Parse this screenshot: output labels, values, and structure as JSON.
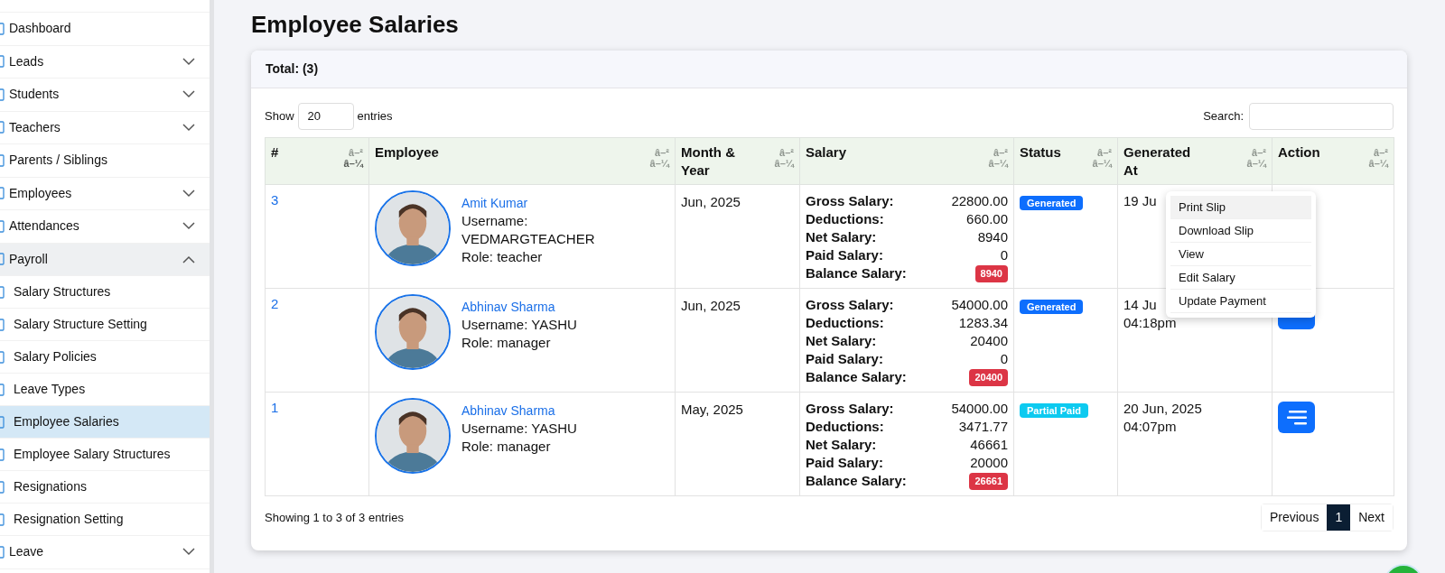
{
  "sidebar": {
    "items": [
      {
        "label": "Dashboard",
        "selected": false
      },
      {
        "label": "Leads",
        "expanded": false,
        "selected": false
      },
      {
        "label": "Students",
        "expanded": false,
        "selected": false
      },
      {
        "label": "Teachers",
        "expanded": false,
        "selected": false
      },
      {
        "label": "Parents / Siblings",
        "selected": false
      },
      {
        "label": "Employees",
        "expanded": false,
        "selected": false
      },
      {
        "label": "Attendances",
        "expanded": false,
        "selected": false
      },
      {
        "label": "Payroll",
        "expanded": true,
        "selected": false,
        "children": [
          {
            "label": "Salary Structures",
            "selected": false
          },
          {
            "label": "Salary Structure Setting",
            "selected": false
          },
          {
            "label": "Salary Policies",
            "selected": false
          },
          {
            "label": "Leave Types",
            "selected": false
          },
          {
            "label": "Employee Salaries",
            "selected": true
          },
          {
            "label": "Employee Salary Structures",
            "selected": false
          },
          {
            "label": "Resignations",
            "selected": false
          },
          {
            "label": "Resignation Setting",
            "selected": false
          }
        ]
      },
      {
        "label": "Leave",
        "expanded": false,
        "selected": false
      }
    ]
  },
  "page_title": "Employee Salaries",
  "card_header": "Total: (3)",
  "length": {
    "prefix": "Show",
    "value": "20",
    "suffix": "entries"
  },
  "search": {
    "label": "Search:"
  },
  "table": {
    "columns": [
      {
        "label": "#",
        "sort_up": "â–²",
        "sort_down": "â–¼"
      },
      {
        "label": "Employee",
        "sort_up": "â–²",
        "sort_down": "â–¼"
      },
      {
        "label": "Month & Year",
        "sort_up": "â–²",
        "sort_down": "â–¼"
      },
      {
        "label": "Salary",
        "sort_up": "â–²",
        "sort_down": "â–¼"
      },
      {
        "label": "Status",
        "sort_up": "â–²",
        "sort_down": "â–¼"
      },
      {
        "label": "Generated At",
        "sort_up": "â–²",
        "sort_down": "â–¼"
      },
      {
        "label": "Action",
        "sort_up": "â–²",
        "sort_down": "â–¼"
      }
    ],
    "rows": [
      {
        "id": "3",
        "name": "Amit Kumar",
        "username": "Username: VEDMARGTEACHER",
        "role": "Role: teacher",
        "month": "Jun, 2025",
        "salary": [
          {
            "label": "Gross Salary:",
            "value": "22800.00"
          },
          {
            "label": "Deductions:",
            "value": "660.00"
          },
          {
            "label": "Net Salary:",
            "value": "8940"
          },
          {
            "label": "Paid Salary:",
            "value": "0"
          },
          {
            "label": "Balance Salary:",
            "value": "8940",
            "kind": "badge"
          }
        ],
        "status": {
          "label": "Generated",
          "color": "#0d6efd"
        },
        "generated": [
          "19 Ju"
        ],
        "menu_open": true
      },
      {
        "id": "2",
        "name": "Abhinav Sharma",
        "username": "Username: YASHU",
        "role": "Role: manager",
        "month": "Jun, 2025",
        "salary": [
          {
            "label": "Gross Salary:",
            "value": "54000.00"
          },
          {
            "label": "Deductions:",
            "value": "1283.34"
          },
          {
            "label": "Net Salary:",
            "value": "20400"
          },
          {
            "label": "Paid Salary:",
            "value": "0"
          },
          {
            "label": "Balance Salary:",
            "value": "20400",
            "kind": "badge"
          }
        ],
        "status": {
          "label": "Generated",
          "color": "#0d6efd"
        },
        "generated": [
          "14 Ju",
          "04:18pm"
        ],
        "menu_open": false
      },
      {
        "id": "1",
        "name": "Abhinav Sharma",
        "username": "Username: YASHU",
        "role": "Role: manager",
        "month": "May, 2025",
        "salary": [
          {
            "label": "Gross Salary:",
            "value": "54000.00"
          },
          {
            "label": "Deductions:",
            "value": "3471.77"
          },
          {
            "label": "Net Salary:",
            "value": "46661"
          },
          {
            "label": "Paid Salary:",
            "value": "20000"
          },
          {
            "label": "Balance Salary:",
            "value": "26661",
            "kind": "badge"
          }
        ],
        "status": {
          "label": "Partial Paid",
          "color": "#0dcaf0"
        },
        "generated": [
          "20 Jun, 2025",
          "04:07pm"
        ],
        "menu_open": false
      }
    ]
  },
  "action_menu": {
    "items": [
      {
        "label": "Print Slip",
        "selected": true
      },
      {
        "label": "Download Slip",
        "selected": false
      },
      {
        "label": "View",
        "selected": false
      },
      {
        "label": "Edit Salary",
        "selected": false
      },
      {
        "label": "Update Payment",
        "selected": false
      }
    ]
  },
  "info": "Showing 1 to 3 of 3 entries",
  "pagination": [
    {
      "label": "Previous",
      "selected": false
    },
    {
      "label": "1",
      "selected": true
    },
    {
      "label": "Next",
      "selected": false
    }
  ]
}
